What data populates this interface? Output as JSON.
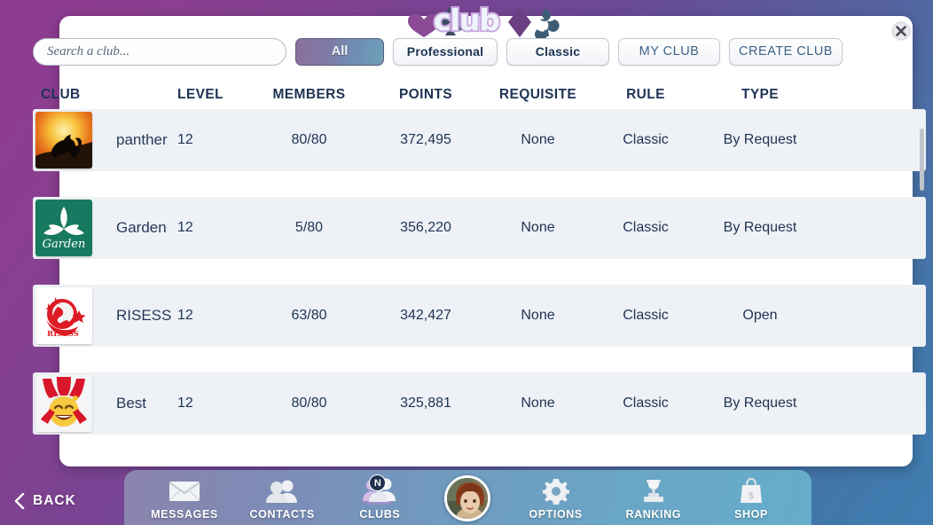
{
  "window": {
    "logo_text": "club",
    "close_label": "✕"
  },
  "search": {
    "placeholder": "Search a club...",
    "value": ""
  },
  "filters": [
    {
      "id": "all",
      "label": "All",
      "active": true
    },
    {
      "id": "professional",
      "label": "Professional",
      "active": false
    },
    {
      "id": "classic",
      "label": "Classic",
      "active": false
    },
    {
      "id": "myclub",
      "label": "MY CLUB",
      "active": false
    },
    {
      "id": "createclub",
      "label": "CREATE CLUB",
      "active": false
    }
  ],
  "table": {
    "headers": {
      "club": "CLUB",
      "level": "LEVEL",
      "members": "MEMBERS",
      "points": "POINTS",
      "requisite": "REQUISITE",
      "rule": "RULE",
      "type": "TYPE"
    },
    "rows": [
      {
        "name": "panther",
        "level": "12",
        "members": "80/80",
        "points": "372,495",
        "requisite": "None",
        "rule": "Classic",
        "type": "By Request",
        "avatar": "panther-avatar"
      },
      {
        "name": "Garden",
        "level": "12",
        "members": "5/80",
        "points": "356,220",
        "requisite": "None",
        "rule": "Classic",
        "type": "By Request",
        "avatar": "garden-avatar"
      },
      {
        "name": "RISESS",
        "level": "12",
        "members": "63/80",
        "points": "342,427",
        "requisite": "None",
        "rule": "Classic",
        "type": "Open",
        "avatar": "risess-avatar"
      },
      {
        "name": "Best",
        "level": "12",
        "members": "80/80",
        "points": "325,881",
        "requisite": "None",
        "rule": "Classic",
        "type": "By Request",
        "avatar": "joker-avatar"
      }
    ]
  },
  "bottom_nav": {
    "back_label": "BACK",
    "items": [
      {
        "id": "messages",
        "label": "MESSAGES",
        "icon": "envelope-icon",
        "active": false,
        "badge": ""
      },
      {
        "id": "contacts",
        "label": "CONTACTS",
        "icon": "people-icon",
        "active": false,
        "badge": ""
      },
      {
        "id": "clubs",
        "label": "CLUBS",
        "icon": "clubs-icon",
        "active": true,
        "badge": "N"
      },
      {
        "id": "profile",
        "label": "",
        "icon": "profile-avatar",
        "active": false,
        "badge": ""
      },
      {
        "id": "options",
        "label": "OPTIONS",
        "icon": "gear-icon",
        "active": false,
        "badge": ""
      },
      {
        "id": "ranking",
        "label": "RANKING",
        "icon": "trophy-icon",
        "active": false,
        "badge": ""
      },
      {
        "id": "shop",
        "label": "SHOP",
        "icon": "bag-icon",
        "active": false,
        "badge": ""
      }
    ]
  },
  "colors": {
    "accent_purple": "#8e3b92",
    "accent_blue": "#3f7db0",
    "text_navy": "#1e3354",
    "row_bg": "#eef1f5"
  }
}
